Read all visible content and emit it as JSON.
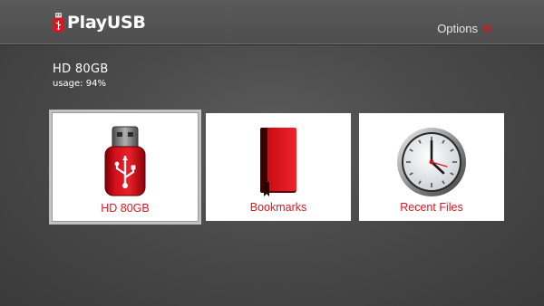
{
  "header": {
    "app_name": "PlayUSB",
    "options_label": "Options"
  },
  "device": {
    "name": "HD 80GB",
    "usage": "usage: 94%"
  },
  "tiles": [
    {
      "label": "HD 80GB",
      "icon": "usb-drive-icon",
      "selected": true
    },
    {
      "label": "Bookmarks",
      "icon": "book-icon",
      "selected": false
    },
    {
      "label": "Recent Files",
      "icon": "clock-icon",
      "selected": false
    }
  ],
  "colors": {
    "accent": "#e0141e",
    "background": "#4a4a4a",
    "tile": "#ffffff",
    "selection_border": "#c2c2c2"
  }
}
